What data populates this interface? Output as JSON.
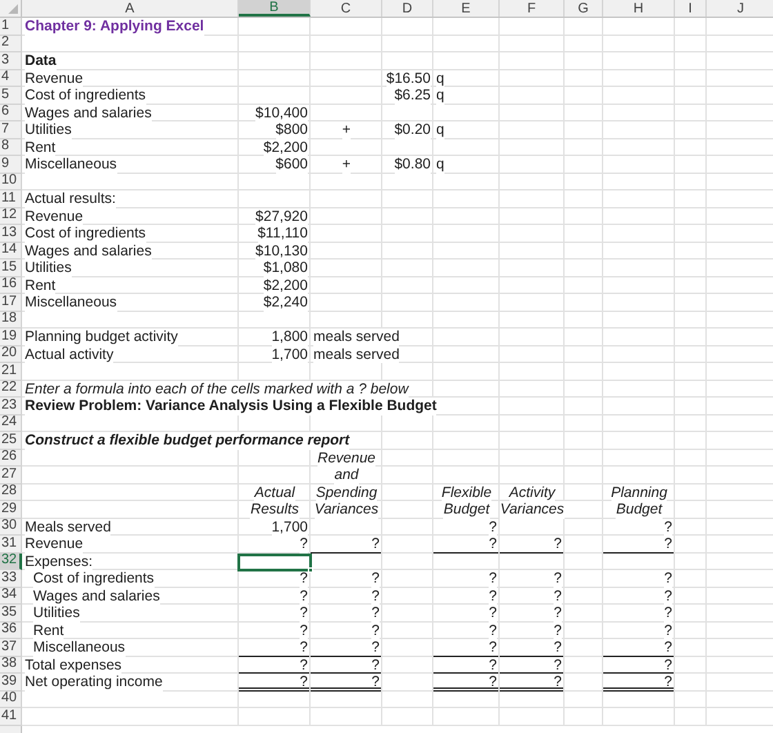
{
  "columns": [
    {
      "label": "A",
      "selected": false
    },
    {
      "label": "B",
      "selected": true
    },
    {
      "label": "C",
      "selected": false
    },
    {
      "label": "D",
      "selected": false
    },
    {
      "label": "E",
      "selected": false
    },
    {
      "label": "F",
      "selected": false
    },
    {
      "label": "G",
      "selected": false
    },
    {
      "label": "H",
      "selected": false
    },
    {
      "label": "I",
      "selected": false
    },
    {
      "label": "J",
      "selected": false
    }
  ],
  "rows": [
    {
      "number": "1",
      "selected": false,
      "a": {
        "text": "Chapter 9: Applying Excel",
        "kind": "title",
        "underlined": false,
        "double_underlined": false
      }
    },
    {
      "number": "2",
      "selected": false
    },
    {
      "number": "3",
      "selected": false,
      "a": {
        "text": "Data",
        "kind": "bold",
        "underlined": false,
        "double_underlined": false
      }
    },
    {
      "number": "4",
      "selected": false,
      "a": {
        "text": "Revenue",
        "kind": "text",
        "underlined": false,
        "double_underlined": false
      },
      "d": {
        "text": "$16.50",
        "kind": "number",
        "underlined": false,
        "double_underlined": false
      },
      "e": {
        "text": "q",
        "kind": "text",
        "underlined": false,
        "double_underlined": false
      }
    },
    {
      "number": "5",
      "selected": false,
      "a": {
        "text": "Cost of ingredients",
        "kind": "text",
        "underlined": false,
        "double_underlined": false
      },
      "d": {
        "text": "$6.25",
        "kind": "number",
        "underlined": false,
        "double_underlined": false
      },
      "e": {
        "text": "q",
        "kind": "text",
        "underlined": false,
        "double_underlined": false
      }
    },
    {
      "number": "6",
      "selected": false,
      "a": {
        "text": "Wages and salaries",
        "kind": "text",
        "underlined": false,
        "double_underlined": false
      },
      "b": {
        "text": "$10,400",
        "kind": "number",
        "underlined": false,
        "double_underlined": false
      }
    },
    {
      "number": "7",
      "selected": false,
      "a": {
        "text": "Utilities",
        "kind": "text",
        "underlined": false,
        "double_underlined": false
      },
      "b": {
        "text": "$800",
        "kind": "number",
        "underlined": false,
        "double_underlined": false
      },
      "c": {
        "text": "+",
        "kind": "center",
        "underlined": false,
        "double_underlined": false
      },
      "d": {
        "text": "$0.20",
        "kind": "number",
        "underlined": false,
        "double_underlined": false
      },
      "e": {
        "text": "q",
        "kind": "text",
        "underlined": false,
        "double_underlined": false
      }
    },
    {
      "number": "8",
      "selected": false,
      "a": {
        "text": "Rent",
        "kind": "text",
        "underlined": false,
        "double_underlined": false
      },
      "b": {
        "text": "$2,200",
        "kind": "number",
        "underlined": false,
        "double_underlined": false
      }
    },
    {
      "number": "9",
      "selected": false,
      "a": {
        "text": "Miscellaneous",
        "kind": "text",
        "underlined": false,
        "double_underlined": false
      },
      "b": {
        "text": "$600",
        "kind": "number",
        "underlined": false,
        "double_underlined": false
      },
      "c": {
        "text": "+",
        "kind": "center",
        "underlined": false,
        "double_underlined": false
      },
      "d": {
        "text": "$0.80",
        "kind": "number",
        "underlined": false,
        "double_underlined": false
      },
      "e": {
        "text": "q",
        "kind": "text",
        "underlined": false,
        "double_underlined": false
      }
    },
    {
      "number": "10",
      "selected": false
    },
    {
      "number": "11",
      "selected": false,
      "a": {
        "text": "Actual results:",
        "kind": "text",
        "underlined": false,
        "double_underlined": false
      }
    },
    {
      "number": "12",
      "selected": false,
      "a": {
        "text": "Revenue",
        "kind": "text",
        "underlined": false,
        "double_underlined": false
      },
      "b": {
        "text": "$27,920",
        "kind": "number",
        "underlined": false,
        "double_underlined": false
      }
    },
    {
      "number": "13",
      "selected": false,
      "a": {
        "text": "Cost of ingredients",
        "kind": "text",
        "underlined": false,
        "double_underlined": false
      },
      "b": {
        "text": "$11,110",
        "kind": "number",
        "underlined": false,
        "double_underlined": false
      }
    },
    {
      "number": "14",
      "selected": false,
      "a": {
        "text": "Wages and salaries",
        "kind": "text",
        "underlined": false,
        "double_underlined": false
      },
      "b": {
        "text": "$10,130",
        "kind": "number",
        "underlined": false,
        "double_underlined": false
      }
    },
    {
      "number": "15",
      "selected": false,
      "a": {
        "text": "Utilities",
        "kind": "text",
        "underlined": false,
        "double_underlined": false
      },
      "b": {
        "text": "$1,080",
        "kind": "number",
        "underlined": false,
        "double_underlined": false
      }
    },
    {
      "number": "16",
      "selected": false,
      "a": {
        "text": "Rent",
        "kind": "text",
        "underlined": false,
        "double_underlined": false
      },
      "b": {
        "text": "$2,200",
        "kind": "number",
        "underlined": false,
        "double_underlined": false
      }
    },
    {
      "number": "17",
      "selected": false,
      "a": {
        "text": "Miscellaneous",
        "kind": "text",
        "underlined": false,
        "double_underlined": false
      },
      "b": {
        "text": "$2,240",
        "kind": "number",
        "underlined": false,
        "double_underlined": false
      }
    },
    {
      "number": "18",
      "selected": false
    },
    {
      "number": "19",
      "selected": false,
      "a": {
        "text": "Planning budget activity",
        "kind": "text",
        "underlined": false,
        "double_underlined": false
      },
      "b": {
        "text": "1,800",
        "kind": "number",
        "underlined": false,
        "double_underlined": false
      },
      "c": {
        "text": "meals served",
        "kind": "text",
        "underlined": false,
        "double_underlined": false
      }
    },
    {
      "number": "20",
      "selected": false,
      "a": {
        "text": "Actual activity",
        "kind": "text",
        "underlined": false,
        "double_underlined": false
      },
      "b": {
        "text": "1,700",
        "kind": "number",
        "underlined": false,
        "double_underlined": false
      },
      "c": {
        "text": "meals served",
        "kind": "text",
        "underlined": false,
        "double_underlined": false
      }
    },
    {
      "number": "21",
      "selected": false
    },
    {
      "number": "22",
      "selected": false,
      "a": {
        "text": "Enter a formula into each of the cells marked with a ? below",
        "kind": "italic",
        "underlined": false,
        "double_underlined": false
      }
    },
    {
      "number": "23",
      "selected": false,
      "a": {
        "text": "Review Problem: Variance Analysis Using a Flexible Budget",
        "kind": "bold",
        "underlined": false,
        "double_underlined": false
      }
    },
    {
      "number": "24",
      "selected": false
    },
    {
      "number": "25",
      "selected": false,
      "a": {
        "text": "Construct a flexible budget performance report",
        "kind": "bold_italic",
        "underlined": false,
        "double_underlined": false
      }
    },
    {
      "number": "26",
      "selected": false,
      "c": {
        "text": "Revenue",
        "kind": "header",
        "underlined": false,
        "double_underlined": false
      }
    },
    {
      "number": "27",
      "selected": false,
      "c": {
        "text": "and",
        "kind": "header",
        "underlined": false,
        "double_underlined": false
      }
    },
    {
      "number": "28",
      "selected": false,
      "b": {
        "text": "Actual",
        "kind": "header",
        "underlined": false,
        "double_underlined": false
      },
      "c": {
        "text": "Spending",
        "kind": "header",
        "underlined": false,
        "double_underlined": false
      },
      "e": {
        "text": "Flexible",
        "kind": "header",
        "underlined": false,
        "double_underlined": false
      },
      "f": {
        "text": "Activity",
        "kind": "header",
        "underlined": false,
        "double_underlined": false
      },
      "h": {
        "text": "Planning",
        "kind": "header",
        "underlined": false,
        "double_underlined": false
      }
    },
    {
      "number": "29",
      "selected": false,
      "b": {
        "text": "Results",
        "kind": "header",
        "underlined": false,
        "double_underlined": false
      },
      "c": {
        "text": "Variances",
        "kind": "header",
        "underlined": false,
        "double_underlined": false
      },
      "e": {
        "text": "Budget",
        "kind": "header",
        "underlined": false,
        "double_underlined": false
      },
      "f": {
        "text": "Variances",
        "kind": "header",
        "underlined": false,
        "double_underlined": false
      },
      "h": {
        "text": "Budget",
        "kind": "header",
        "underlined": false,
        "double_underlined": false
      }
    },
    {
      "number": "30",
      "selected": false,
      "a": {
        "text": "Meals served",
        "kind": "text",
        "underlined": false,
        "double_underlined": false
      },
      "b": {
        "text": "1,700",
        "kind": "number",
        "underlined": false,
        "double_underlined": false
      },
      "e": {
        "text": "?",
        "kind": "number",
        "underlined": false,
        "double_underlined": false
      },
      "h": {
        "text": "?",
        "kind": "number",
        "underlined": false,
        "double_underlined": false
      }
    },
    {
      "number": "31",
      "selected": false,
      "a": {
        "text": "Revenue",
        "kind": "text",
        "underlined": false,
        "double_underlined": false
      },
      "b": {
        "text": "?",
        "kind": "number",
        "underlined": false,
        "double_underlined": false
      },
      "c": {
        "text": "?",
        "kind": "number",
        "underlined": true,
        "double_underlined": false
      },
      "e": {
        "text": "?",
        "kind": "number",
        "underlined": true,
        "double_underlined": false
      },
      "f": {
        "text": "?",
        "kind": "number",
        "underlined": true,
        "double_underlined": false
      },
      "h": {
        "text": "?",
        "kind": "number",
        "underlined": true,
        "double_underlined": false
      }
    },
    {
      "number": "32",
      "selected": true,
      "a": {
        "text": "Expenses:",
        "kind": "text",
        "underlined": false,
        "double_underlined": false
      }
    },
    {
      "number": "33",
      "selected": false,
      "a": {
        "text": "Cost of ingredients",
        "kind": "indent",
        "underlined": false,
        "double_underlined": false
      },
      "b": {
        "text": "?",
        "kind": "number",
        "underlined": false,
        "double_underlined": false
      },
      "c": {
        "text": "?",
        "kind": "number",
        "underlined": false,
        "double_underlined": false
      },
      "e": {
        "text": "?",
        "kind": "number",
        "underlined": false,
        "double_underlined": false
      },
      "f": {
        "text": "?",
        "kind": "number",
        "underlined": false,
        "double_underlined": false
      },
      "h": {
        "text": "?",
        "kind": "number",
        "underlined": false,
        "double_underlined": false
      }
    },
    {
      "number": "34",
      "selected": false,
      "a": {
        "text": "Wages and salaries",
        "kind": "indent",
        "underlined": false,
        "double_underlined": false
      },
      "b": {
        "text": "?",
        "kind": "number",
        "underlined": false,
        "double_underlined": false
      },
      "c": {
        "text": "?",
        "kind": "number",
        "underlined": false,
        "double_underlined": false
      },
      "e": {
        "text": "?",
        "kind": "number",
        "underlined": false,
        "double_underlined": false
      },
      "f": {
        "text": "?",
        "kind": "number",
        "underlined": false,
        "double_underlined": false
      },
      "h": {
        "text": "?",
        "kind": "number",
        "underlined": false,
        "double_underlined": false
      }
    },
    {
      "number": "35",
      "selected": false,
      "a": {
        "text": "Utilities",
        "kind": "indent",
        "underlined": false,
        "double_underlined": false
      },
      "b": {
        "text": "?",
        "kind": "number",
        "underlined": false,
        "double_underlined": false
      },
      "c": {
        "text": "?",
        "kind": "number",
        "underlined": false,
        "double_underlined": false
      },
      "e": {
        "text": "?",
        "kind": "number",
        "underlined": false,
        "double_underlined": false
      },
      "f": {
        "text": "?",
        "kind": "number",
        "underlined": false,
        "double_underlined": false
      },
      "h": {
        "text": "?",
        "kind": "number",
        "underlined": false,
        "double_underlined": false
      }
    },
    {
      "number": "36",
      "selected": false,
      "a": {
        "text": "Rent",
        "kind": "indent",
        "underlined": false,
        "double_underlined": false
      },
      "b": {
        "text": "?",
        "kind": "number",
        "underlined": false,
        "double_underlined": false
      },
      "c": {
        "text": "?",
        "kind": "number",
        "underlined": false,
        "double_underlined": false
      },
      "e": {
        "text": "?",
        "kind": "number",
        "underlined": false,
        "double_underlined": false
      },
      "f": {
        "text": "?",
        "kind": "number",
        "underlined": false,
        "double_underlined": false
      },
      "h": {
        "text": "?",
        "kind": "number",
        "underlined": false,
        "double_underlined": false
      }
    },
    {
      "number": "37",
      "selected": false,
      "a": {
        "text": "Miscellaneous",
        "kind": "indent",
        "underlined": false,
        "double_underlined": false
      },
      "b": {
        "text": "?",
        "kind": "number",
        "underlined": true,
        "double_underlined": false
      },
      "c": {
        "text": "?",
        "kind": "number",
        "underlined": true,
        "double_underlined": false
      },
      "e": {
        "text": "?",
        "kind": "number",
        "underlined": true,
        "double_underlined": false
      },
      "f": {
        "text": "?",
        "kind": "number",
        "underlined": true,
        "double_underlined": false
      },
      "h": {
        "text": "?",
        "kind": "number",
        "underlined": true,
        "double_underlined": false
      }
    },
    {
      "number": "38",
      "selected": false,
      "a": {
        "text": "Total expenses",
        "kind": "text",
        "underlined": false,
        "double_underlined": false
      },
      "b": {
        "text": "?",
        "kind": "number",
        "underlined": true,
        "double_underlined": false
      },
      "c": {
        "text": "?",
        "kind": "number",
        "underlined": true,
        "double_underlined": false
      },
      "e": {
        "text": "?",
        "kind": "number",
        "underlined": true,
        "double_underlined": false
      },
      "f": {
        "text": "?",
        "kind": "number",
        "underlined": true,
        "double_underlined": false
      },
      "h": {
        "text": "?",
        "kind": "number",
        "underlined": true,
        "double_underlined": false
      }
    },
    {
      "number": "39",
      "selected": false,
      "a": {
        "text": "Net operating income",
        "kind": "text",
        "underlined": false,
        "double_underlined": false
      },
      "b": {
        "text": "?",
        "kind": "number",
        "underlined": false,
        "double_underlined": true
      },
      "c": {
        "text": "?",
        "kind": "number",
        "underlined": false,
        "double_underlined": true
      },
      "e": {
        "text": "?",
        "kind": "number",
        "underlined": false,
        "double_underlined": true
      },
      "f": {
        "text": "?",
        "kind": "number",
        "underlined": false,
        "double_underlined": true
      },
      "h": {
        "text": "?",
        "kind": "number",
        "underlined": false,
        "double_underlined": true
      }
    },
    {
      "number": "40",
      "selected": false
    },
    {
      "number": "41",
      "selected": false
    }
  ]
}
